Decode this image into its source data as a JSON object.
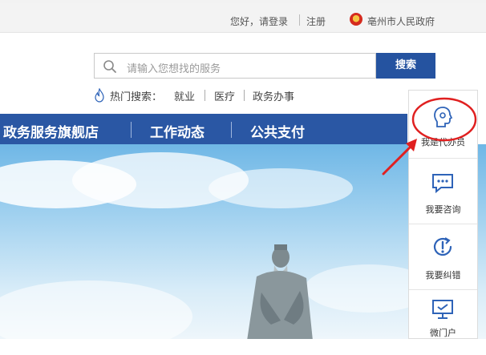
{
  "topbar": {
    "greeting": "您好，请登录",
    "register": "注册",
    "gov_name": "亳州市人民政府"
  },
  "search": {
    "placeholder": "请输入您想找的服务",
    "button": "搜索"
  },
  "hot_search": {
    "label": "热门搜索：",
    "keywords": [
      "就业",
      "医疗",
      "政务办事"
    ]
  },
  "nav": {
    "items": [
      "政务服务旗舰店",
      "工作动态",
      "公共支付"
    ]
  },
  "float_panel": {
    "items": [
      {
        "label": "我是代办员",
        "icon": "agent-head-icon"
      },
      {
        "label": "我要咨询",
        "icon": "chat-bubble-icon"
      },
      {
        "label": "我要纠错",
        "icon": "refresh-alert-icon"
      },
      {
        "label": "微门户",
        "icon": "monitor-icon"
      }
    ]
  },
  "colors": {
    "brand_blue": "#2a57a4",
    "button_blue": "#2553a0",
    "icon_blue": "#2e63b8",
    "annotation_red": "#e02020"
  }
}
